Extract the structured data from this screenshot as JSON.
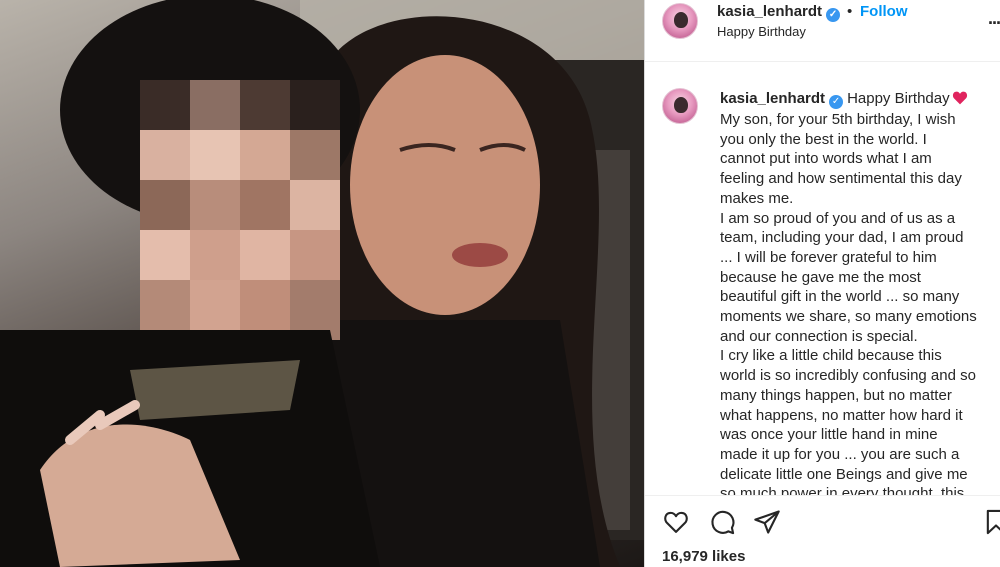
{
  "post": {
    "username": "kasia_lenhardt",
    "follow_label": "Follow",
    "separator": "•",
    "location_text": "Happy Birthday",
    "more_label": "...",
    "verified_glyph": "✓"
  },
  "caption": {
    "username": "kasia_lenhardt",
    "title": "Happy Birthday",
    "emoji": "red-heart-icon",
    "lines": [
      "My son, for your 5th birthday, I wish",
      "you only the best in the world. I",
      "cannot put into words what I am",
      "feeling and how sentimental this day",
      "makes me.",
      "I am so proud of you and of us as a",
      "team, including your dad, I am proud",
      "... I will be forever grateful to him",
      "because he gave me the most",
      "beautiful gift in the world ... so many",
      "moments we share, so many emotions",
      "and our connection is special.",
      "I cry like a little child because this",
      "world is so incredibly confusing and so",
      "many things happen, but no matter",
      "what happens, no matter how hard it",
      "was once your little hand in mine",
      "made it up for you ... you are such a",
      "delicate little one Beings and give me",
      "so much power in every thought, this"
    ]
  },
  "footer": {
    "likes": "16,979 likes",
    "icons": [
      "heart-icon",
      "comment-icon",
      "share-icon",
      "bookmark-icon"
    ]
  },
  "colors": {
    "accent": "#0095f6",
    "verified": "#3897f0",
    "text": "#262626",
    "heart": "#ed4956"
  }
}
